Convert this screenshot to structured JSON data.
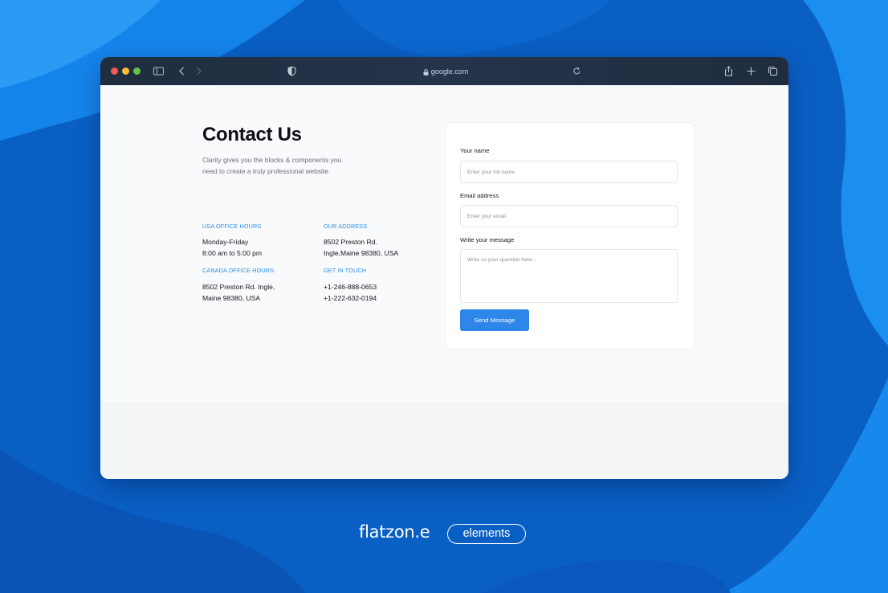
{
  "browser": {
    "url": "google.com"
  },
  "contact": {
    "title": "Contact Us",
    "subtitle": "Clarity gives you the blocks & components you need to create a truly professional website.",
    "usa_hours": {
      "label": "USA OFFICE HOURS",
      "line1": "Monday-Friday",
      "line2": "8:00 am to 5:00 pm"
    },
    "address": {
      "label": "OUR ADDRESS",
      "line1": "8502 Preston Rd.",
      "line2": "Ingle,Maine 98380, USA"
    },
    "canada_hours": {
      "label": "CANADA OFFICE HOURS",
      "line1": "8502 Preston Rd. Ingle,",
      "line2": "Maine 98380, USA"
    },
    "touch": {
      "label": "GET IN TOUCH",
      "line1": "+1-246-888-0653",
      "line2": "+1-222-632-0194"
    }
  },
  "form": {
    "name_label": "Your name",
    "name_placeholder": "Enter your full name",
    "email_label": "Email address",
    "email_placeholder": "Enter your email",
    "message_label": "Write your message",
    "message_placeholder": "Write us your question here...",
    "send_label": "Send Message"
  },
  "brand": {
    "wordmark": "flatzon.e",
    "pill": "elements"
  },
  "colors": {
    "accent": "#2d86e8",
    "label_blue": "#2d8fe6",
    "titlebar": "#1f2d3f"
  }
}
